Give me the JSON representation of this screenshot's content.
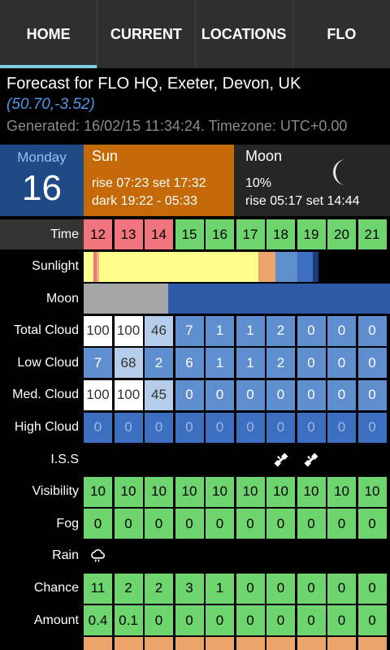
{
  "tabs": [
    "HOME",
    "CURRENT",
    "LOCATIONS",
    "FLO"
  ],
  "header": {
    "title": "Forecast for FLO HQ, Exeter, Devon, UK",
    "coords": "(50.70,-3.52)",
    "generated": "Generated: 16/02/15 11:34:24. Timezone: UTC+0.00"
  },
  "day": {
    "name": "Monday",
    "num": "16"
  },
  "sun": {
    "title": "Sun",
    "line1": "rise 07:23 set 17:32",
    "line2": "dark 19:22 - 05:33"
  },
  "moon": {
    "title": "Moon",
    "line1": "10%",
    "line2": "rise 05:17 set 14:44"
  },
  "labels": {
    "time": "Time",
    "sunlight": "Sunlight",
    "moon": "Moon",
    "total_cloud": "Total Cloud",
    "low_cloud": "Low Cloud",
    "med_cloud": "Med. Cloud",
    "high_cloud": "High Cloud",
    "iss": "I.S.S",
    "visibility": "Visibility",
    "fog": "Fog",
    "rain": "Rain",
    "chance": "Chance",
    "amount": "Amount"
  },
  "hours": [
    "12",
    "13",
    "14",
    "15",
    "16",
    "17",
    "18",
    "19",
    "20",
    "21"
  ],
  "rows": {
    "total_cloud": [
      "100",
      "100",
      "46",
      "7",
      "1",
      "1",
      "2",
      "0",
      "0",
      "0"
    ],
    "low_cloud": [
      "7",
      "68",
      "2",
      "6",
      "1",
      "1",
      "2",
      "0",
      "0",
      "0"
    ],
    "med_cloud": [
      "100",
      "100",
      "45",
      "0",
      "0",
      "0",
      "0",
      "0",
      "0",
      "0"
    ],
    "high_cloud": [
      "0",
      "0",
      "0",
      "0",
      "0",
      "0",
      "0",
      "0",
      "0",
      "0"
    ],
    "visibility": [
      "10",
      "10",
      "10",
      "10",
      "10",
      "10",
      "10",
      "10",
      "10",
      "10"
    ],
    "fog": [
      "0",
      "0",
      "0",
      "0",
      "0",
      "0",
      "0",
      "0",
      "0",
      "0"
    ],
    "chance": [
      "11",
      "2",
      "2",
      "3",
      "1",
      "0",
      "0",
      "0",
      "0",
      "0"
    ],
    "amount": [
      "0.4",
      "0.1",
      "0",
      "0",
      "0",
      "0",
      "0",
      "0",
      "0",
      "0"
    ]
  },
  "colors": {
    "tab_bar": "#2f2f2f",
    "tab_indicator": "#7fcde0",
    "day_bg": "#1f4a86",
    "sun_bg": "#c46a08",
    "moon_bg": "#262626",
    "time_red": "#f0757c",
    "time_green": "#6ed46e",
    "cloud_blue": "#5f8ecf",
    "cloud_light": "#b5cdea"
  },
  "icons": {
    "iss": "satellite-icon",
    "rain": "rain-cloud-icon",
    "moon": "crescent-moon-icon"
  }
}
